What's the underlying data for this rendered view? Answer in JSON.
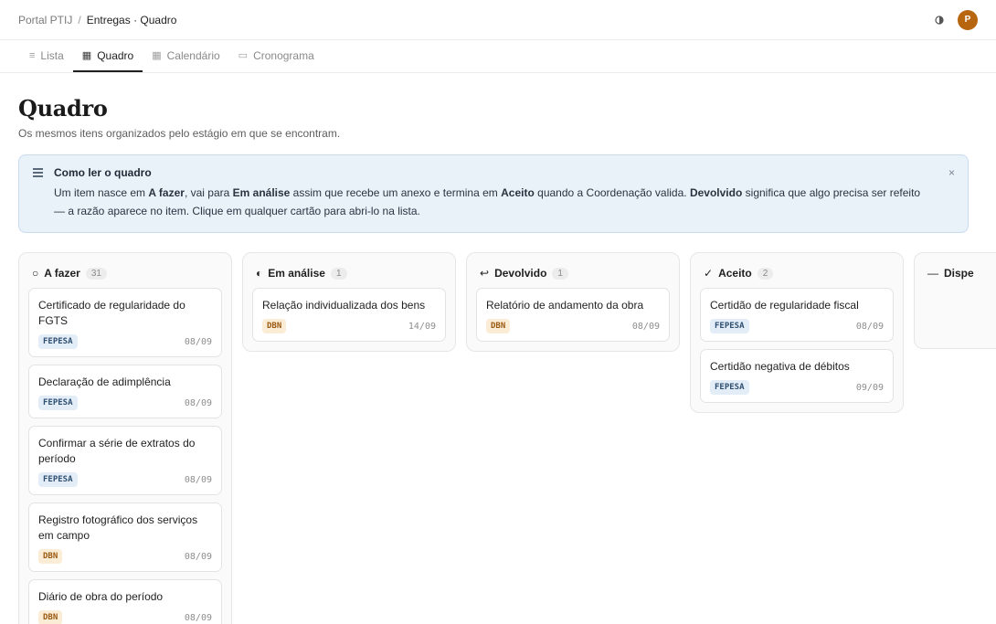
{
  "breadcrumb": {
    "root": "Portal PTIJ",
    "separator": "/",
    "current": "Entregas · Quadro"
  },
  "header": {
    "avatar_initial": "P"
  },
  "tabs": [
    {
      "label": "Lista",
      "icon": "list-icon",
      "glyph": "≡"
    },
    {
      "label": "Quadro",
      "icon": "board-icon",
      "glyph": "▦"
    },
    {
      "label": "Calendário",
      "icon": "calendar-icon",
      "glyph": "▦"
    },
    {
      "label": "Cronograma",
      "icon": "timeline-icon",
      "glyph": "▭"
    }
  ],
  "page": {
    "title": "Quadro",
    "subtitle": "Os mesmos itens organizados pelo estágio em que se encontram."
  },
  "info": {
    "title": "Como ler o quadro",
    "p1": "Um item nasce em ",
    "b1": "A fazer",
    "p2": ", vai para ",
    "b2": "Em análise",
    "p3": " assim que recebe um anexo e termina em ",
    "b3": "Aceito",
    "p4": " quando a Coordenação valida. ",
    "b4": "Devolvido",
    "p5": " significa que algo precisa ser refeito — a razão aparece no item. Clique em qualquer cartão para abri-lo na lista.",
    "close": "×"
  },
  "columns": [
    {
      "symbol": "○",
      "title": "A fazer",
      "count": "31",
      "cards": [
        {
          "title": "Certificado de regularidade do FGTS",
          "tag": "FEPESA",
          "date": "08/09"
        },
        {
          "title": "Declaração de adimplência",
          "tag": "FEPESA",
          "date": "08/09"
        },
        {
          "title": "Confirmar a série de extratos do período",
          "tag": "FEPESA",
          "date": "08/09"
        },
        {
          "title": "Registro fotográfico dos serviços em campo",
          "tag": "DBN",
          "date": "08/09"
        },
        {
          "title": "Diário de obra do período",
          "tag": "DBN",
          "date": "08/09"
        }
      ]
    },
    {
      "symbol": "◐",
      "title": "Em análise",
      "count": "1",
      "cards": [
        {
          "title": "Relação individualizada dos bens",
          "tag": "DBN",
          "date": "14/09"
        }
      ]
    },
    {
      "symbol": "↩",
      "title": "Devolvido",
      "count": "1",
      "cards": [
        {
          "title": "Relatório de andamento da obra",
          "tag": "DBN",
          "date": "08/09"
        }
      ]
    },
    {
      "symbol": "✓",
      "title": "Aceito",
      "count": "2",
      "cards": [
        {
          "title": "Certidão de regularidade fiscal",
          "tag": "FEPESA",
          "date": "08/09"
        },
        {
          "title": "Certidão negativa de débitos",
          "tag": "FEPESA",
          "date": "09/09"
        }
      ]
    },
    {
      "symbol": "—",
      "title": "Dispe",
      "count": "",
      "cards": []
    }
  ],
  "colors": {
    "accent": "#1f1f1f",
    "avatar": "#b8650f",
    "info_bg": "#e9f1f9",
    "tag_fepesa": "#e3edf8",
    "tag_dbn": "#fbecd6"
  }
}
